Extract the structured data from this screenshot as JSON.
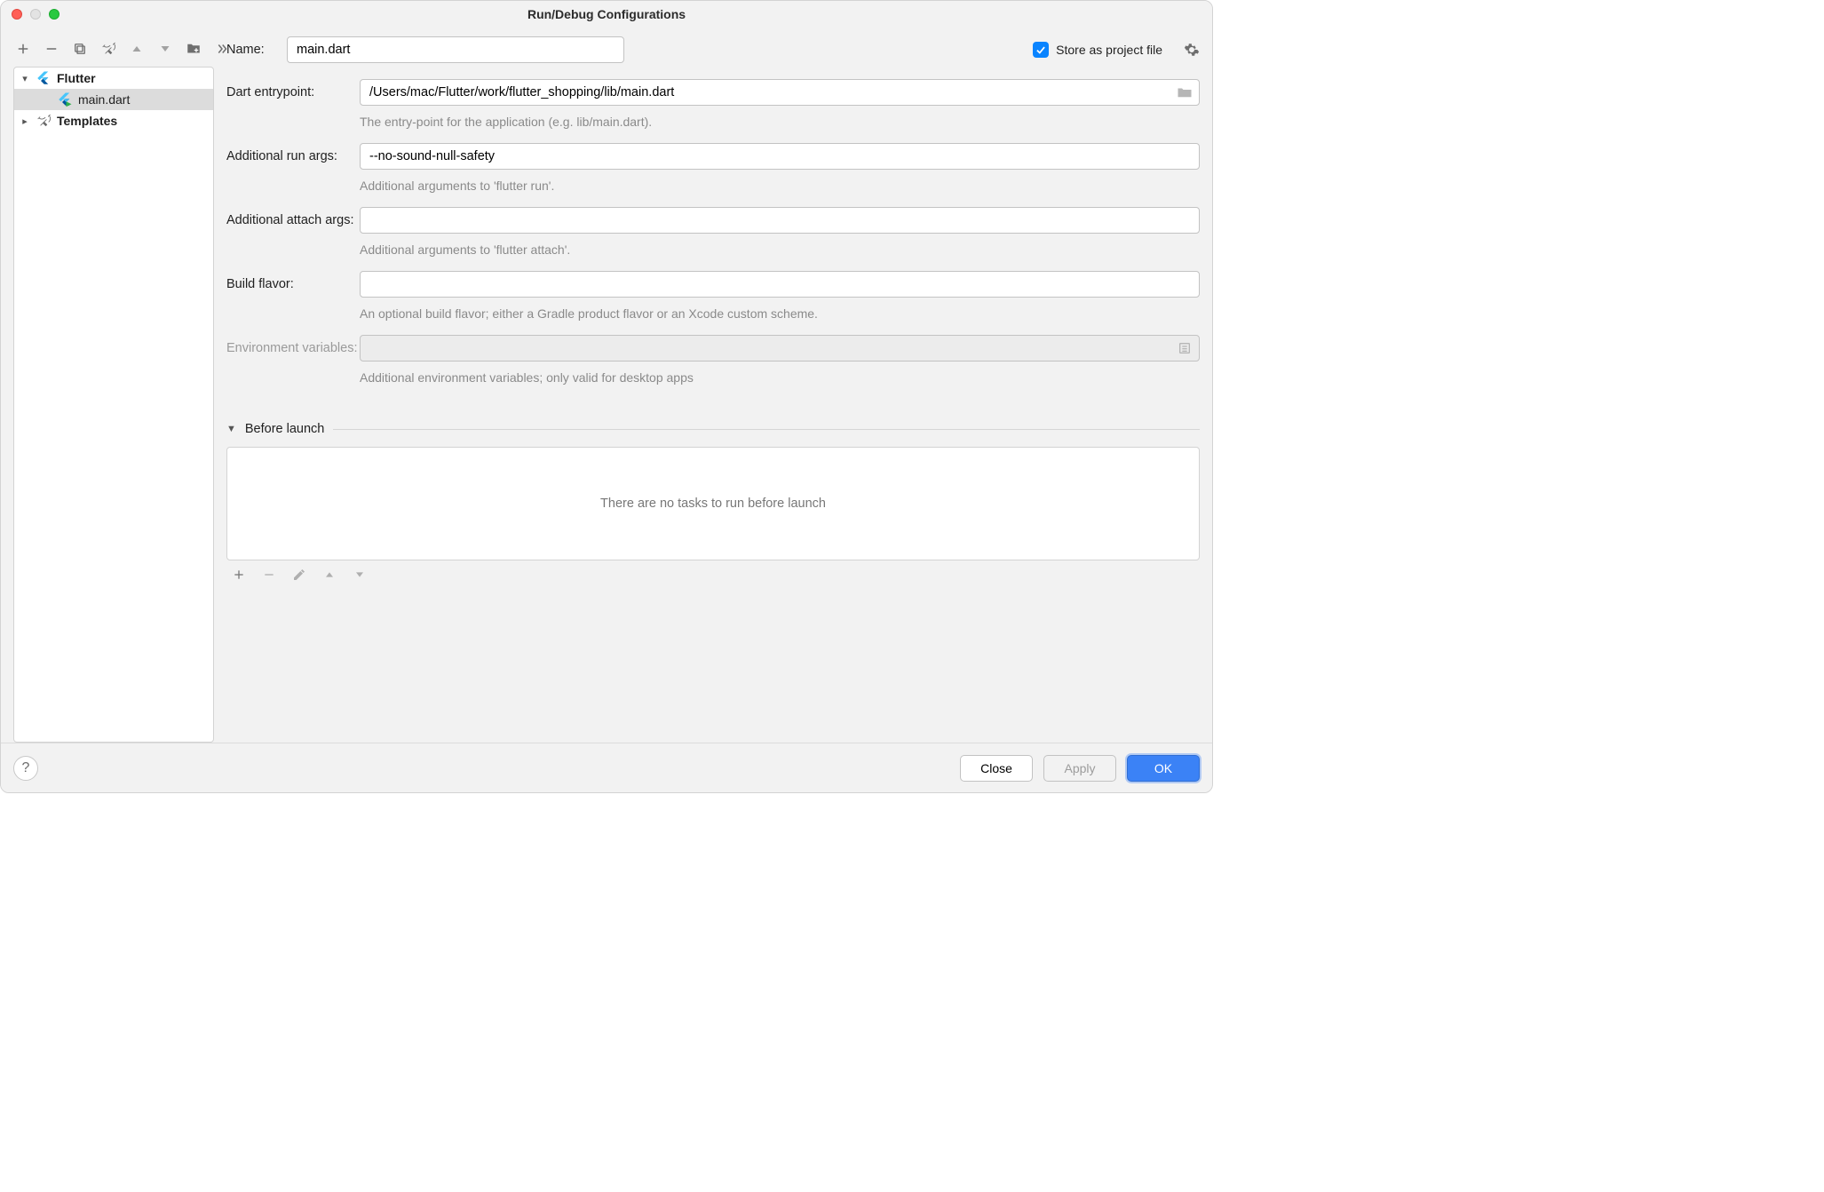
{
  "window": {
    "title": "Run/Debug Configurations"
  },
  "toolbar": {
    "add": "Add",
    "remove": "Remove",
    "copy": "Copy",
    "edit": "Edit",
    "up": "Up",
    "down": "Down",
    "folder": "Folder",
    "more": "More"
  },
  "sidebar": {
    "flutter_label": "Flutter",
    "flutter_item": "main.dart",
    "templates_label": "Templates"
  },
  "form": {
    "name_label": "Name:",
    "name_value": "main.dart",
    "store_label": "Store as project file",
    "store_checked": true,
    "dart_entry_label": "Dart entrypoint:",
    "dart_entry_value": "/Users/mac/Flutter/work/flutter_shopping/lib/main.dart",
    "dart_entry_hint": "The entry-point for the application (e.g. lib/main.dart).",
    "run_args_label": "Additional run args:",
    "run_args_value": "--no-sound-null-safety",
    "run_args_hint": "Additional arguments to 'flutter run'.",
    "attach_args_label": "Additional attach args:",
    "attach_args_value": "",
    "attach_args_hint": "Additional arguments to 'flutter attach'.",
    "build_flavor_label": "Build flavor:",
    "build_flavor_value": "",
    "build_flavor_hint": "An optional build flavor; either a Gradle product flavor or an Xcode custom scheme.",
    "env_label": "Environment variables:",
    "env_value": "",
    "env_hint": "Additional environment variables; only valid for desktop apps"
  },
  "before_launch": {
    "section_label": "Before launch",
    "empty_text": "There are no tasks to run before launch"
  },
  "footer": {
    "close": "Close",
    "apply": "Apply",
    "ok": "OK"
  }
}
